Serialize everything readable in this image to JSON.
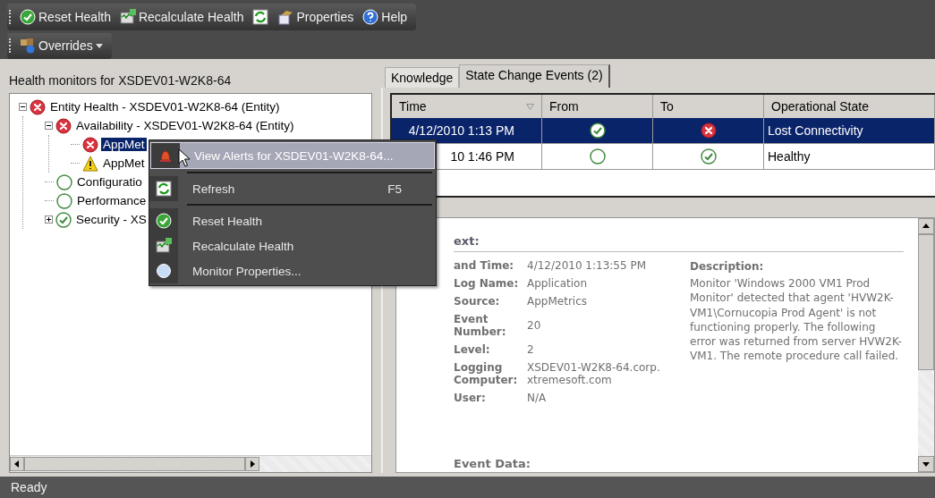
{
  "toolbar": {
    "buttons": [
      {
        "label": "Reset Health"
      },
      {
        "label": "Recalculate Health"
      },
      {
        "kind": "icon_only"
      },
      {
        "label": "Properties"
      },
      {
        "label": "Help"
      }
    ]
  },
  "toolbar2": {
    "buttons": [
      {
        "label": "Overrides",
        "dropdown": true
      }
    ]
  },
  "left_pane": {
    "title": "Health monitors for XSDEV01-W2K8-64",
    "tree": [
      {
        "label": "Entity Health - XSDEV01-W2K8-64 (Entity)",
        "kind": "error",
        "expanded": true,
        "selected": false,
        "children": [
          {
            "label": "Availability - XSDEV01-W2K8-64 (Entity)",
            "kind": "error",
            "expanded": true,
            "selected": false,
            "children": [
              {
                "label": "AppMet",
                "kind": "error",
                "selected": true
              },
              {
                "label": "AppMet",
                "kind": "warning",
                "selected": false
              }
            ]
          },
          {
            "label": "Configuratio",
            "kind": "unknown",
            "selected": false
          },
          {
            "label": "Performance",
            "kind": "unknown",
            "selected": false
          },
          {
            "label": "Security - XS",
            "kind": "healthy",
            "expanded": false,
            "selected": false
          }
        ]
      }
    ]
  },
  "right_pane": {
    "tabs": [
      {
        "label": "Knowledge",
        "selected": false
      },
      {
        "label": "State Change Events (2)",
        "selected": true
      }
    ],
    "table": {
      "columns": [
        "Time",
        "From",
        "To",
        "Operational State"
      ],
      "rows": [
        {
          "time": "4/12/2010 1:13 PM",
          "from": {
            "kind": "healthy"
          },
          "to": {
            "kind": "error"
          },
          "state": "Lost Connectivity",
          "selected": true
        },
        {
          "time": "10 1:46 PM",
          "from": {
            "kind": "unknown"
          },
          "to": {
            "kind": "healthy"
          },
          "state": "Healthy",
          "selected": false
        }
      ]
    },
    "details": {
      "heading": "ext:",
      "fields": [
        {
          "label": "and Time:",
          "value": "4/12/2010 1:13:55 PM"
        },
        {
          "label": "Log Name:",
          "value": "Application"
        },
        {
          "label": "Source:",
          "value": "AppMetrics"
        },
        {
          "label": "Event Number:",
          "value": "20"
        },
        {
          "label": "Level:",
          "value": "2"
        },
        {
          "label": "Logging Computer:",
          "value": "XSDEV01-W2K8-64.corp.xtremesoft.com"
        },
        {
          "label": "User:",
          "value": "N/A"
        }
      ],
      "description_title": "Description:",
      "description": "Monitor 'Windows 2000 VM1 Prod Monitor' detected that agent 'HVW2K-VM1\\Cornucopia Prod Agent' is not functioning properly. The following error was returned from server HVW2K-VM1. The remote procedure call failed.",
      "event_data_title": "Event Data:"
    }
  },
  "context_menu": [
    {
      "kind": "item",
      "label": "View Alerts for XSDEV01-W2K8-64...",
      "selected": true
    },
    {
      "kind": "separator"
    },
    {
      "kind": "item",
      "label": "Refresh",
      "shortcut": "F5",
      "selected": false
    },
    {
      "kind": "separator"
    },
    {
      "kind": "item",
      "label": "Reset Health",
      "selected": false
    },
    {
      "kind": "item",
      "label": "Recalculate Health",
      "selected": false
    },
    {
      "kind": "item",
      "label": "Monitor Properties...",
      "selected": false
    }
  ],
  "status_bar": "Ready"
}
